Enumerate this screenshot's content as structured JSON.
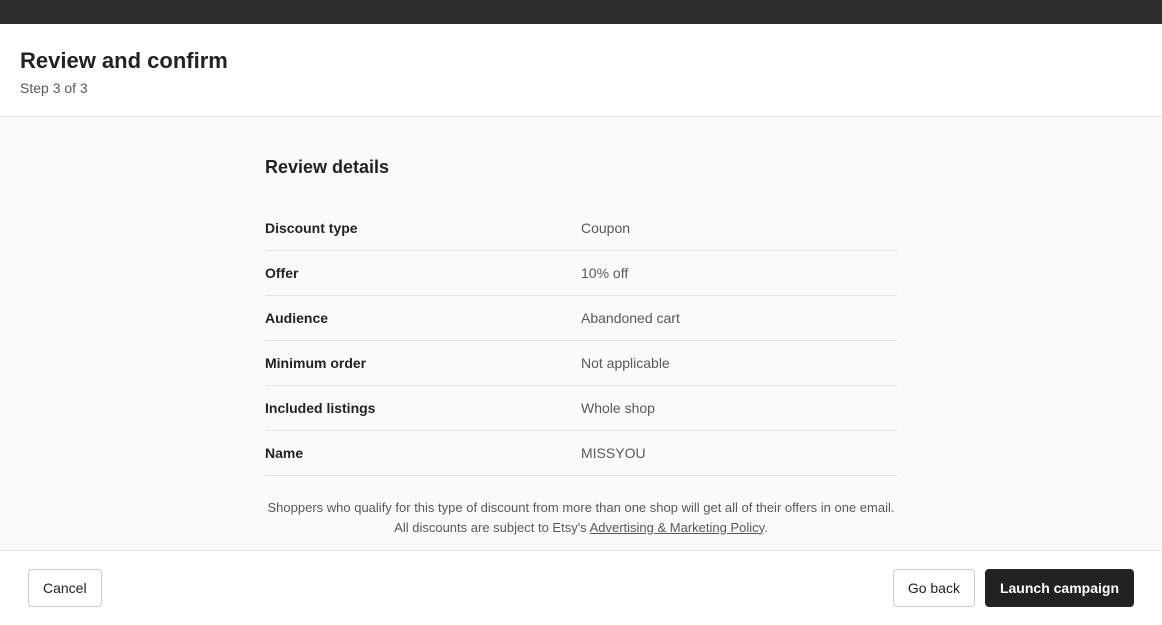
{
  "header": {
    "title": "Review and confirm",
    "step": "Step 3 of 3"
  },
  "section": {
    "title": "Review details"
  },
  "details": {
    "discount_type": {
      "label": "Discount type",
      "value": "Coupon"
    },
    "offer": {
      "label": "Offer",
      "value": "10% off"
    },
    "audience": {
      "label": "Audience",
      "value": "Abandoned cart"
    },
    "minimum_order": {
      "label": "Minimum order",
      "value": "Not applicable"
    },
    "included_listings": {
      "label": "Included listings",
      "value": "Whole shop"
    },
    "name": {
      "label": "Name",
      "value": "MISSYOU"
    }
  },
  "disclaimer": {
    "line1": "Shoppers who qualify for this type of discount from more than one shop will get all of their offers in one email.",
    "line2_prefix": "All discounts are subject to Etsy's ",
    "policy_link": "Advertising & Marketing Policy",
    "line2_suffix": "."
  },
  "footer": {
    "cancel": "Cancel",
    "go_back": "Go back",
    "launch": "Launch campaign"
  }
}
